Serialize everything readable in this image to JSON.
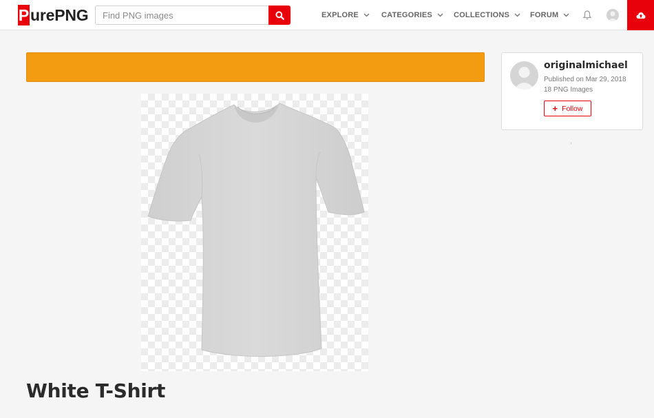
{
  "header": {
    "logo_initial": "P",
    "logo_rest": "urePNG",
    "search_placeholder": "Find PNG images",
    "nav": [
      {
        "label": "EXPLORE"
      },
      {
        "label": "CATEGORIES"
      },
      {
        "label": "COLLECTIONS"
      },
      {
        "label": "FORUM"
      }
    ],
    "accent_color": "#e8000b"
  },
  "banner": {
    "color": "#f39c12"
  },
  "image": {
    "alt": "White T-Shirt",
    "icon": "tshirt-image"
  },
  "page": {
    "title": "White T-Shirt"
  },
  "author": {
    "name": "originalmichael",
    "published": "Published on Mar 29, 2018",
    "count": "18 PNG Images",
    "follow_label": "Follow"
  }
}
